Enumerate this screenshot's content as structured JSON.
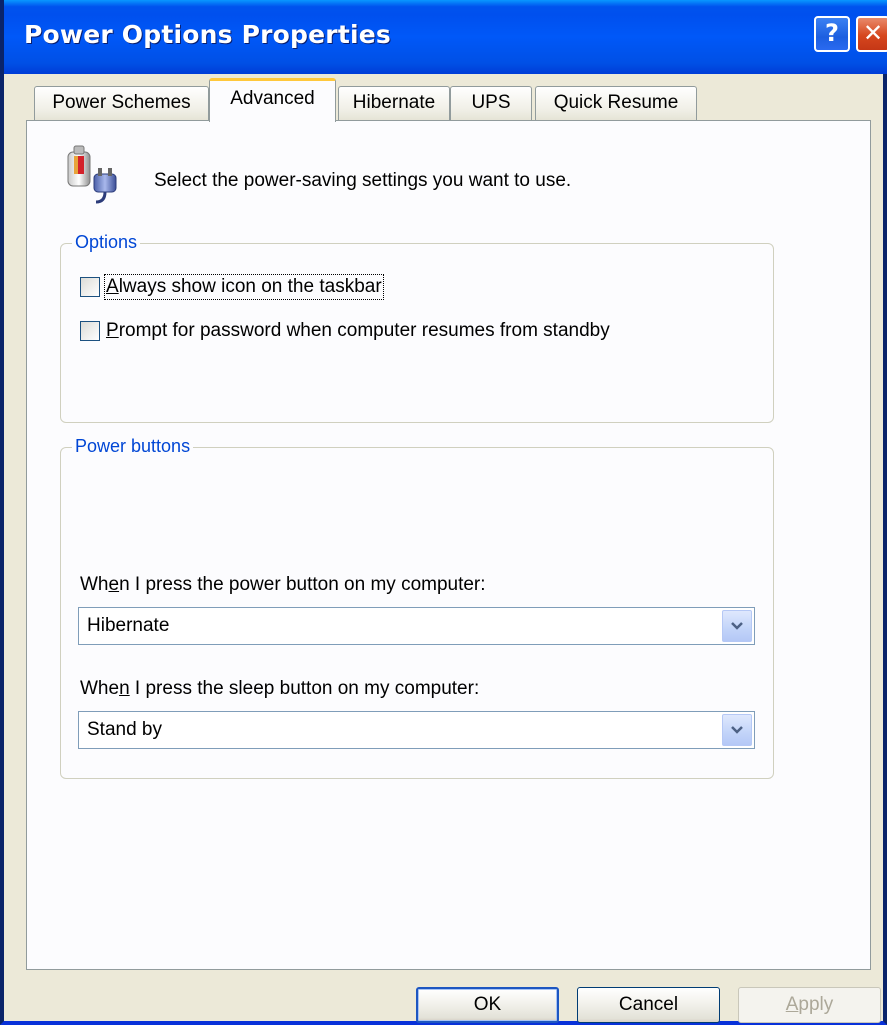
{
  "window": {
    "title": "Power Options Properties",
    "help_label": "?",
    "close_label": "✕"
  },
  "tabs": [
    {
      "label": "Power Schemes",
      "active": false
    },
    {
      "label": "Advanced",
      "active": true
    },
    {
      "label": "Hibernate",
      "active": false
    },
    {
      "label": "UPS",
      "active": false
    },
    {
      "label": "Quick Resume",
      "active": false
    }
  ],
  "intro_text": "Select the power-saving settings you want to use.",
  "options_group": {
    "label": "Options",
    "checkboxes": [
      {
        "label_prefix": "",
        "accel": "A",
        "label_rest": "lways show icon on the taskbar",
        "checked": false,
        "focused": true
      },
      {
        "label_prefix": "",
        "accel": "P",
        "label_rest": "rompt for password when computer resumes from standby",
        "checked": false,
        "focused": false
      }
    ]
  },
  "power_buttons_group": {
    "label": "Power buttons",
    "power_button": {
      "label_prefix": "Wh",
      "accel": "e",
      "label_rest": "n I press the power button on my computer:",
      "selected": "Hibernate"
    },
    "sleep_button": {
      "label_prefix": "Whe",
      "accel": "n",
      "label_rest": " I press the sleep button on my computer:",
      "selected": "Stand by"
    }
  },
  "buttons": {
    "ok": "OK",
    "cancel": "Cancel",
    "apply_accel": "A",
    "apply_rest": "pply"
  },
  "icons": {
    "power_options": "power-options-icon",
    "dropdown": "chevron-down-icon"
  },
  "colors": {
    "titlebar": "#0058f8",
    "group_label": "#0046d5",
    "active_tab_highlight": "#ffc83c"
  }
}
